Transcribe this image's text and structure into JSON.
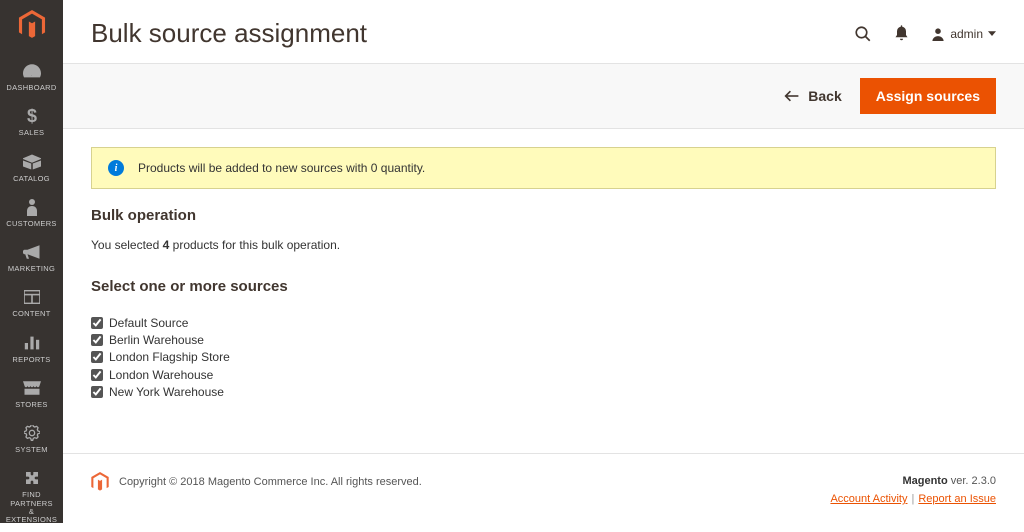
{
  "sidebar": {
    "items": [
      {
        "label": "DASHBOARD"
      },
      {
        "label": "SALES"
      },
      {
        "label": "CATALOG"
      },
      {
        "label": "CUSTOMERS"
      },
      {
        "label": "MARKETING"
      },
      {
        "label": "CONTENT"
      },
      {
        "label": "REPORTS"
      },
      {
        "label": "STORES"
      },
      {
        "label": "SYSTEM"
      },
      {
        "label": "FIND PARTNERS\n& EXTENSIONS"
      }
    ]
  },
  "header": {
    "page_title": "Bulk source assignment",
    "user_label": "admin"
  },
  "actions": {
    "back_label": "Back",
    "primary_label": "Assign sources"
  },
  "notice": {
    "text": "Products will be added to new sources with 0 quantity."
  },
  "bulk": {
    "title": "Bulk operation",
    "text_prefix": "You selected ",
    "count": "4",
    "text_suffix": " products for this bulk operation."
  },
  "sources": {
    "title": "Select one or more sources",
    "items": [
      {
        "label": "Default Source",
        "checked": true
      },
      {
        "label": "Berlin Warehouse",
        "checked": true
      },
      {
        "label": "London Flagship Store",
        "checked": true
      },
      {
        "label": "London Warehouse",
        "checked": true
      },
      {
        "label": "New York Warehouse",
        "checked": true
      }
    ]
  },
  "footer": {
    "copyright": "Copyright © 2018 Magento Commerce Inc. All rights reserved.",
    "product": "Magento",
    "ver_prefix": " ver. ",
    "version": "2.3.0",
    "link_activity": "Account Activity",
    "link_issue": "Report an Issue"
  }
}
